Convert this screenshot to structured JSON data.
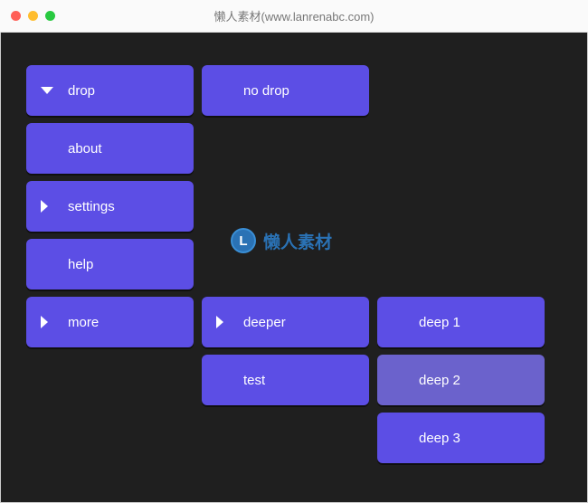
{
  "titlebar": {
    "title": "懒人素材(www.lanrenabc.com)"
  },
  "menu": {
    "col1": [
      {
        "label": "drop",
        "chevron": "down"
      },
      {
        "label": "about",
        "chevron": "none"
      },
      {
        "label": "settings",
        "chevron": "right"
      },
      {
        "label": "help",
        "chevron": "none"
      },
      {
        "label": "more",
        "chevron": "right"
      }
    ],
    "col1_right": {
      "label": "no drop",
      "chevron": "none"
    },
    "col2": [
      {
        "label": "deeper",
        "chevron": "right"
      },
      {
        "label": "test",
        "chevron": "none"
      }
    ],
    "col3": [
      {
        "label": "deep 1",
        "chevron": "none",
        "dim": false
      },
      {
        "label": "deep 2",
        "chevron": "none",
        "dim": true
      },
      {
        "label": "deep 3",
        "chevron": "none",
        "dim": false
      }
    ]
  },
  "watermark": {
    "letter": "L",
    "text": "懒人素材"
  }
}
